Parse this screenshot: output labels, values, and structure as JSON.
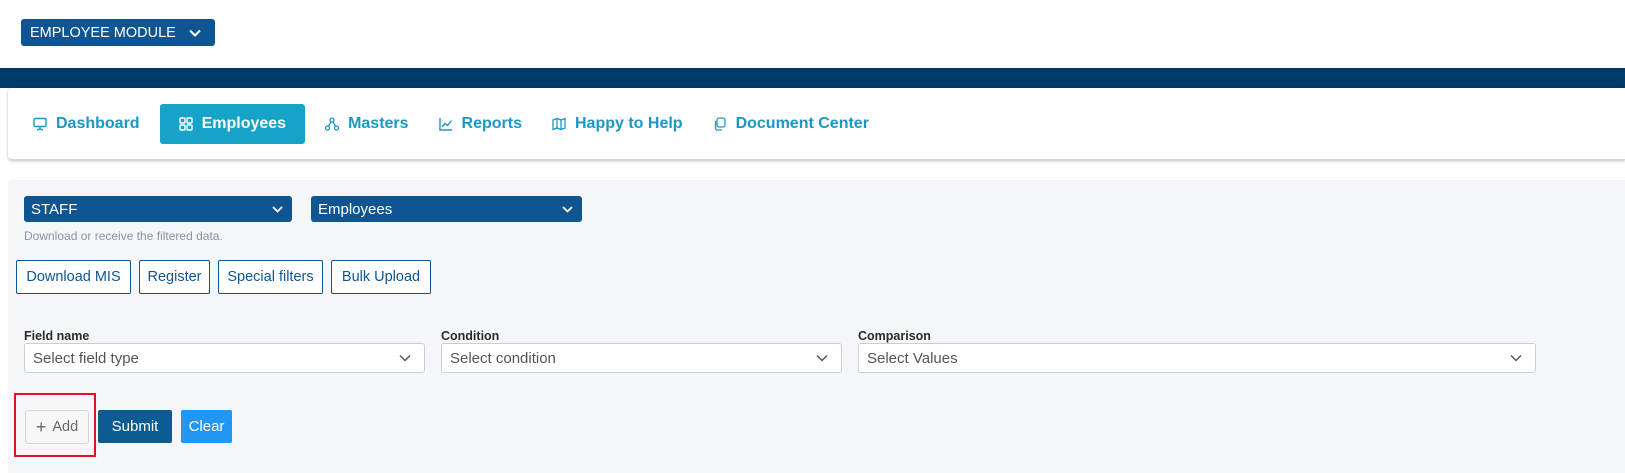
{
  "module_selector": {
    "label": "EMPLOYEE MODULE"
  },
  "nav": {
    "items": [
      {
        "label": "Dashboard",
        "icon": "monitor-icon"
      },
      {
        "label": "Employees",
        "icon": "grid-icon",
        "active": true
      },
      {
        "label": "Masters",
        "icon": "sitemap-icon"
      },
      {
        "label": "Reports",
        "icon": "chart-line-icon"
      },
      {
        "label": "Happy to Help",
        "icon": "map-icon"
      },
      {
        "label": "Document Center",
        "icon": "copy-icon"
      }
    ]
  },
  "filters": {
    "category_select": "STAFF",
    "type_select": "Employees",
    "hint": "Download or receive the filtered data."
  },
  "actions": {
    "download_mis": "Download MIS",
    "register": "Register",
    "special_filters": "Special filters",
    "bulk_upload": "Bulk Upload"
  },
  "query": {
    "field_name": {
      "label": "Field name",
      "placeholder": "Select field type"
    },
    "condition": {
      "label": "Condition",
      "placeholder": "Select condition"
    },
    "comparison": {
      "label": "Comparison",
      "placeholder": "Select Values"
    }
  },
  "buttons": {
    "add": "Add",
    "submit": "Submit",
    "clear": "Clear"
  },
  "colors": {
    "primary": "#0f5592",
    "banner": "#003a6a",
    "nav_text": "#1a97c4",
    "nav_active": "#17a2c7",
    "clear": "#2196f3",
    "highlight": "#e0141e"
  }
}
